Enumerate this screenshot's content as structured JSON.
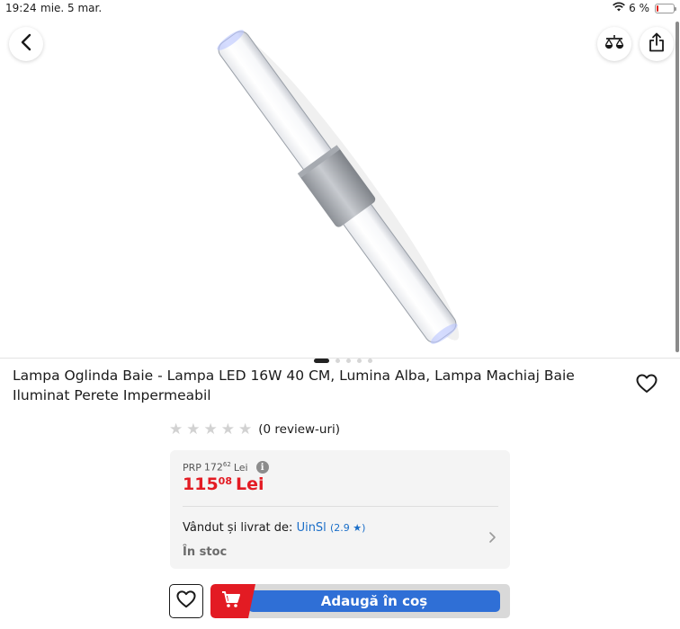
{
  "status": {
    "time": "19:24",
    "date": "mie. 5 mar.",
    "battery": "6 %",
    "battery_level": 0.06
  },
  "header": {
    "back_icon": "chevron-left-icon",
    "compare_icon": "scale-icon",
    "share_icon": "share-icon"
  },
  "gallery": {
    "image_count": 5,
    "active_index": 0
  },
  "product": {
    "title": "Lampa Oglinda Baie - Lampa LED 16W 40 CM, Lumina Alba, Lampa Machiaj Baie Iluminat Perete Impermeabil",
    "rating": {
      "stars": 0,
      "max": 5,
      "reviews_label": "(0 review-uri)"
    }
  },
  "pricing": {
    "prp_label": "PRP",
    "prp_whole": "172",
    "prp_fraction": "62",
    "prp_currency": "Lei",
    "price_whole": "115",
    "price_fraction": "08",
    "price_currency": "Lei"
  },
  "seller": {
    "label": "Vândut și livrat de:",
    "name": "UinSl",
    "score": "(2.9 ★)",
    "stock": "În stoc"
  },
  "actions": {
    "add_to_cart": "Adaugă în coș"
  },
  "colors": {
    "price_red": "#e31b23",
    "cart_blue": "#2f6fd6",
    "seller_link": "#1a6ec8"
  }
}
